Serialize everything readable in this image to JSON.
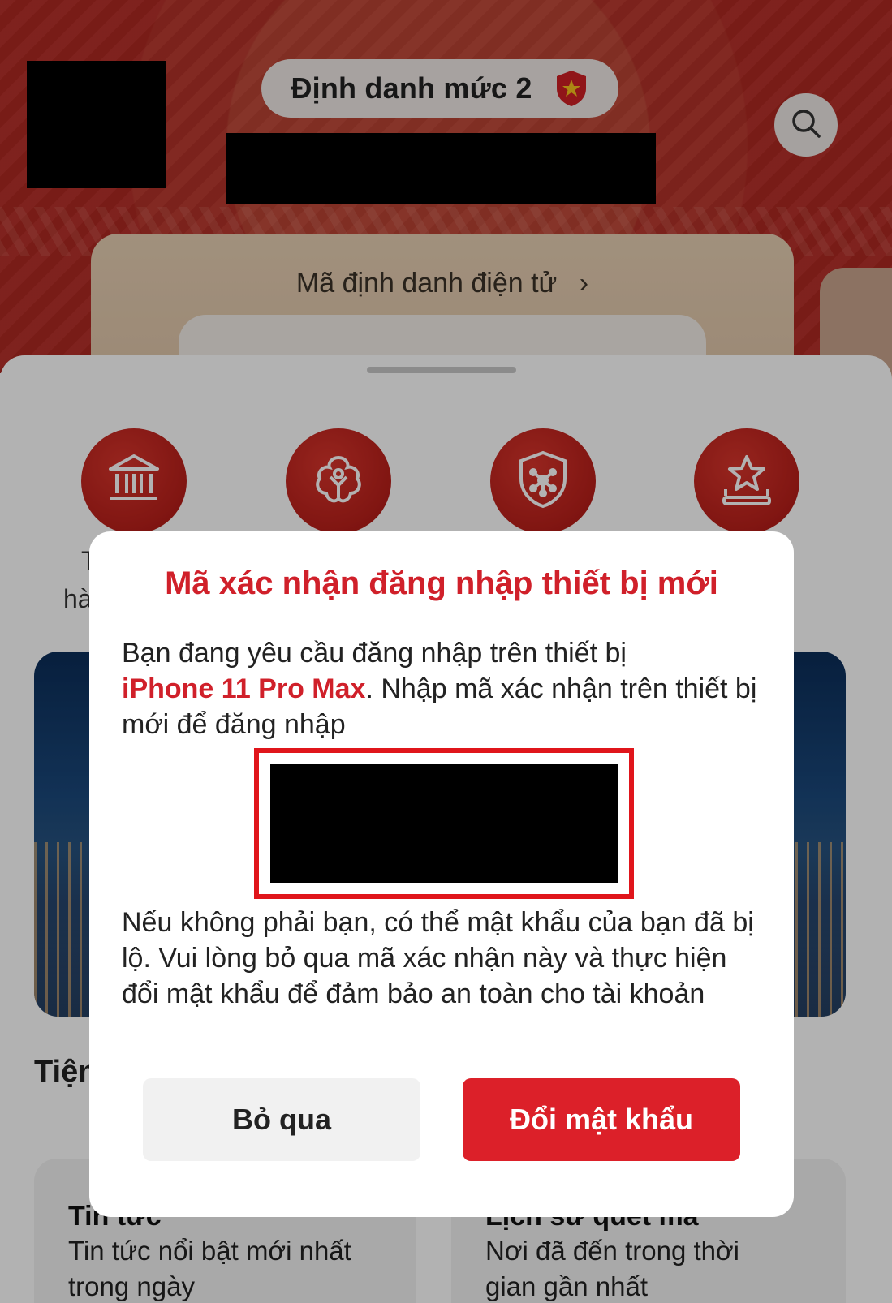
{
  "header": {
    "level_badge": "Định danh mức 2",
    "id_card_title": "Mã định danh điện tử"
  },
  "services": [
    {
      "icon": "bank-icon",
      "label": "T"
    },
    {
      "icon": "flower-person-icon",
      "label": ""
    },
    {
      "icon": "shield-network-icon",
      "label": ""
    },
    {
      "icon": "star-podium-icon",
      "label": ""
    }
  ],
  "services_partial_label": "hà",
  "section": {
    "title": "Tiện"
  },
  "features": [
    {
      "title": "Tin tức",
      "desc_line1": "Tin tức nổi bật mới nhất",
      "desc_line2": "trong ngày"
    },
    {
      "title": "Lịch sử quét mã",
      "desc_line1": "Nơi đã đến trong thời",
      "desc_line2": "gian gần nhất"
    }
  ],
  "modal": {
    "title": "Mã xác nhận đăng nhập thiết bị mới",
    "body_prefix": "Bạn đang yêu cầu đăng nhập trên thiết bị",
    "device_name": "iPhone 11 Pro Max",
    "body_suffix": ". Nhập mã xác nhận trên thiết bị mới để đăng nhập",
    "warning": "Nếu không phải bạn, có thể mật khẩu của bạn đã bị lộ. Vui lòng bỏ qua mã xác nhận này và thực hiện đổi mật khẩu để đảm bảo an toàn cho tài khoản",
    "skip_label": "Bỏ qua",
    "change_password_label": "Đổi mật khẩu"
  },
  "colors": {
    "brand_red": "#d0202a",
    "header_red": "#b32a23",
    "highlight_border": "#e0151b"
  }
}
